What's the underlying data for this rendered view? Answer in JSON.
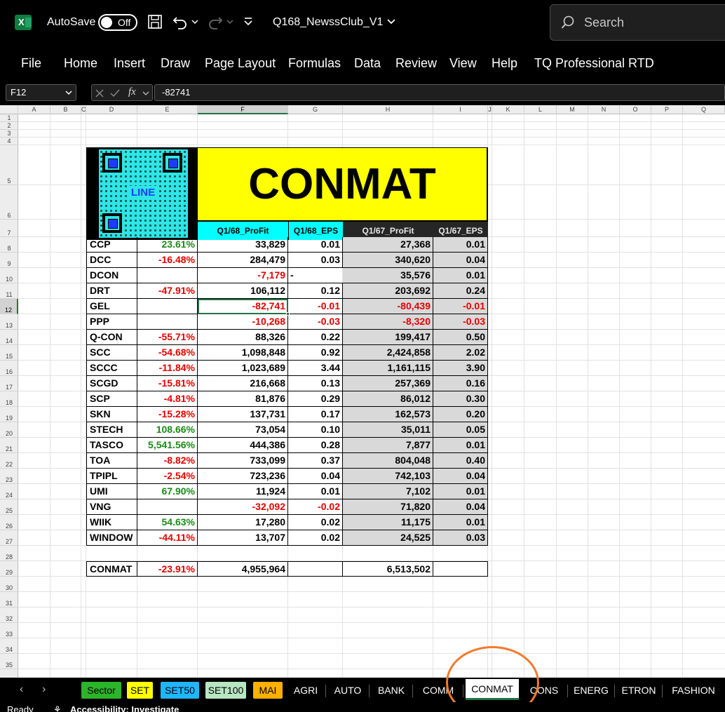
{
  "titlebar": {
    "app_icon": "excel-icon",
    "autosave_label": "AutoSave",
    "autosave_state": "Off",
    "filename": "Q168_NewssClub_V1",
    "search_placeholder": "Search"
  },
  "ribbon": {
    "tabs": [
      "File",
      "Home",
      "Insert",
      "Draw",
      "Page Layout",
      "Formulas",
      "Data",
      "Review",
      "View",
      "Help",
      "TQ Professional RTD"
    ]
  },
  "formula_bar": {
    "name_box": "F12",
    "fx": "fx",
    "formula": "-82741"
  },
  "columns": [
    "A",
    "B",
    "C",
    "D",
    "E",
    "F",
    "G",
    "H",
    "I",
    "J",
    "K",
    "L",
    "M",
    "N",
    "O",
    "P",
    "Q"
  ],
  "rows": [
    "1",
    "2",
    "3",
    "4",
    "5",
    "6",
    "7",
    "8",
    "9",
    "10",
    "11",
    "12",
    "13",
    "14",
    "15",
    "16",
    "17",
    "18",
    "19",
    "20",
    "21",
    "22",
    "23",
    "24",
    "25",
    "26",
    "27",
    "28",
    "29",
    "30",
    "31",
    "32",
    "33",
    "34",
    "35"
  ],
  "sheet": {
    "title": "CONMAT",
    "qr_label": "LINE",
    "headers": [
      "Q1/68_ProFit",
      "Q1/68_EPS",
      "Q1/67_ProFit",
      "Q1/67_EPS"
    ],
    "rows": [
      {
        "name": "CCP",
        "pct": "23.61%",
        "profit68": "33,829",
        "eps68": "0.01",
        "profit67": "27,368",
        "eps67": "0.01"
      },
      {
        "name": "DCC",
        "pct": "-16.48%",
        "profit68": "284,479",
        "eps68": "0.03",
        "profit67": "340,620",
        "eps67": "0.04"
      },
      {
        "name": "DCON",
        "pct": "",
        "profit68": "-7,179",
        "eps68": "-",
        "profit67": "35,576",
        "eps67": "0.01"
      },
      {
        "name": "DRT",
        "pct": "-47.91%",
        "profit68": "106,112",
        "eps68": "0.12",
        "profit67": "203,692",
        "eps67": "0.24"
      },
      {
        "name": "GEL",
        "pct": "",
        "profit68": "-82,741",
        "eps68": "-0.01",
        "profit67": "-80,439",
        "eps67": "-0.01"
      },
      {
        "name": "PPP",
        "pct": "",
        "profit68": "-10,268",
        "eps68": "-0.03",
        "profit67": "-8,320",
        "eps67": "-0.03"
      },
      {
        "name": "Q-CON",
        "pct": "-55.71%",
        "profit68": "88,326",
        "eps68": "0.22",
        "profit67": "199,417",
        "eps67": "0.50"
      },
      {
        "name": "SCC",
        "pct": "-54.68%",
        "profit68": "1,098,848",
        "eps68": "0.92",
        "profit67": "2,424,858",
        "eps67": "2.02"
      },
      {
        "name": "SCCC",
        "pct": "-11.84%",
        "profit68": "1,023,689",
        "eps68": "3.44",
        "profit67": "1,161,115",
        "eps67": "3.90"
      },
      {
        "name": "SCGD",
        "pct": "-15.81%",
        "profit68": "216,668",
        "eps68": "0.13",
        "profit67": "257,369",
        "eps67": "0.16"
      },
      {
        "name": "SCP",
        "pct": "-4.81%",
        "profit68": "81,876",
        "eps68": "0.29",
        "profit67": "86,012",
        "eps67": "0.30"
      },
      {
        "name": "SKN",
        "pct": "-15.28%",
        "profit68": "137,731",
        "eps68": "0.17",
        "profit67": "162,573",
        "eps67": "0.20"
      },
      {
        "name": "STECH",
        "pct": "108.66%",
        "profit68": "73,054",
        "eps68": "0.10",
        "profit67": "35,011",
        "eps67": "0.05"
      },
      {
        "name": "TASCO",
        "pct": "5,541.56%",
        "profit68": "444,386",
        "eps68": "0.28",
        "profit67": "7,877",
        "eps67": "0.01"
      },
      {
        "name": "TOA",
        "pct": "-8.82%",
        "profit68": "733,099",
        "eps68": "0.37",
        "profit67": "804,048",
        "eps67": "0.40"
      },
      {
        "name": "TPIPL",
        "pct": "-2.54%",
        "profit68": "723,236",
        "eps68": "0.04",
        "profit67": "742,103",
        "eps67": "0.04"
      },
      {
        "name": "UMI",
        "pct": "67.90%",
        "profit68": "11,924",
        "eps68": "0.01",
        "profit67": "7,102",
        "eps67": "0.01"
      },
      {
        "name": "VNG",
        "pct": "",
        "profit68": "-32,092",
        "eps68": "-0.02",
        "profit67": "71,820",
        "eps67": "0.04"
      },
      {
        "name": "WIIK",
        "pct": "54.63%",
        "profit68": "17,280",
        "eps68": "0.02",
        "profit67": "11,175",
        "eps67": "0.01"
      },
      {
        "name": "WINDOW",
        "pct": "-44.11%",
        "profit68": "13,707",
        "eps68": "0.02",
        "profit67": "24,525",
        "eps67": "0.03"
      }
    ],
    "total": {
      "name": "CONMAT",
      "pct": "-23.91%",
      "profit68": "4,955,964",
      "eps68": "",
      "profit67": "6,513,502",
      "eps67": ""
    }
  },
  "sheet_tabs": [
    {
      "label": "Sector",
      "color": "#2bb52b"
    },
    {
      "label": "SET",
      "color": "#ffff00"
    },
    {
      "label": "SET50",
      "color": "#1fb6ff"
    },
    {
      "label": "SET100",
      "color": "#b8e6c2"
    },
    {
      "label": "MAI",
      "color": "#ffb000"
    },
    {
      "label": "AGRI",
      "color": ""
    },
    {
      "label": "AUTO",
      "color": ""
    },
    {
      "label": "BANK",
      "color": ""
    },
    {
      "label": "COMM",
      "color": ""
    },
    {
      "label": "CONMAT",
      "color": "",
      "active": true
    },
    {
      "label": "CONS",
      "color": ""
    },
    {
      "label": "ENERG",
      "color": ""
    },
    {
      "label": "ETRON",
      "color": ""
    },
    {
      "label": "FASHION",
      "color": ""
    }
  ],
  "status": {
    "ready": "Ready",
    "accessibility": "Accessibility: Investigate"
  }
}
